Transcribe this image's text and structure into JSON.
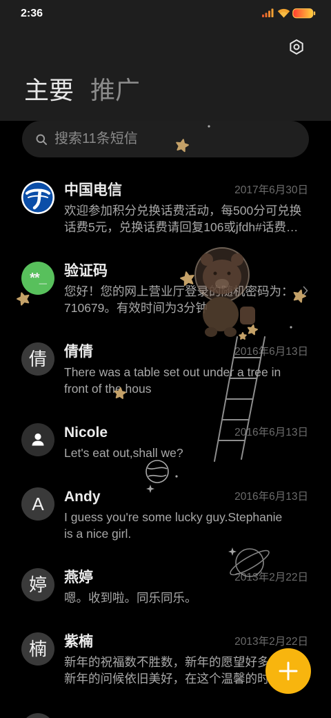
{
  "status_bar": {
    "time": "2:36",
    "icons": [
      "signal-icon",
      "wifi-icon",
      "battery-icon"
    ]
  },
  "header": {
    "settings_icon": "settings-icon",
    "tabs": [
      {
        "label": "主要",
        "active": true
      },
      {
        "label": "推广",
        "active": false
      }
    ]
  },
  "search": {
    "icon": "search-icon",
    "placeholder": "搜索11条短信"
  },
  "conversations": [
    {
      "name": "中国电信",
      "date": "2017年6月30日",
      "preview": [
        "欢迎参加积分兑换话费活动，每500分可兑换",
        "话费5元，兑换话费请回复106或jfdh#话费…"
      ],
      "avatar": {
        "icon": "china-telecom-logo-icon",
        "brand_color": "#0b4ea8"
      }
    },
    {
      "name": "验证码",
      "preview": [
        "您好！您的网上营业厅登录的随机密码为：",
        "710679。有效时间为3分钟"
      ],
      "avatar": {
        "icon": "verification-code-icon",
        "text": "**_",
        "bg": "#58c05c"
      },
      "trailing_icon": "chevron-right-icon"
    },
    {
      "name": "倩倩",
      "date": "2016年6月13日",
      "preview": [
        "There was a table set out under a tree in",
        "front of the hous"
      ],
      "avatar": {
        "text": "倩",
        "bg": "#3a3a3a"
      }
    },
    {
      "name": "Nicole",
      "date": "2016年6月13日",
      "preview": [
        "Let's eat out,shall we?"
      ],
      "avatar": {
        "icon": "person-icon",
        "bg": "#2e2e2e"
      }
    },
    {
      "name": "Andy",
      "date": "2016年6月13日",
      "preview": [
        "I guess you're some lucky guy.Stephanie",
        "is a nice girl."
      ],
      "avatar": {
        "text": "A",
        "bg": "#3a3a3a"
      }
    },
    {
      "name": "燕婷",
      "date": "2013年2月22日",
      "preview": [
        "嗯。收到啦。同乐同乐。"
      ],
      "avatar": {
        "text": "婷",
        "bg": "#3a3a3a"
      }
    },
    {
      "name": "紫楠",
      "date": "2013年2月22日",
      "preview": [
        "新年的祝福数不胜数，新年的愿望好多",
        "新年的问候依旧美好，在这个温馨的时"
      ],
      "avatar": {
        "text": "楠",
        "bg": "#3a3a3a"
      }
    }
  ],
  "fab": {
    "icon": "plus-icon",
    "color": "#f8b50e"
  },
  "colors": {
    "header_bg": "#1e1e1e",
    "background": "#000000",
    "accent": "#f8b50e",
    "wallpaper_star": "#c4a168"
  }
}
